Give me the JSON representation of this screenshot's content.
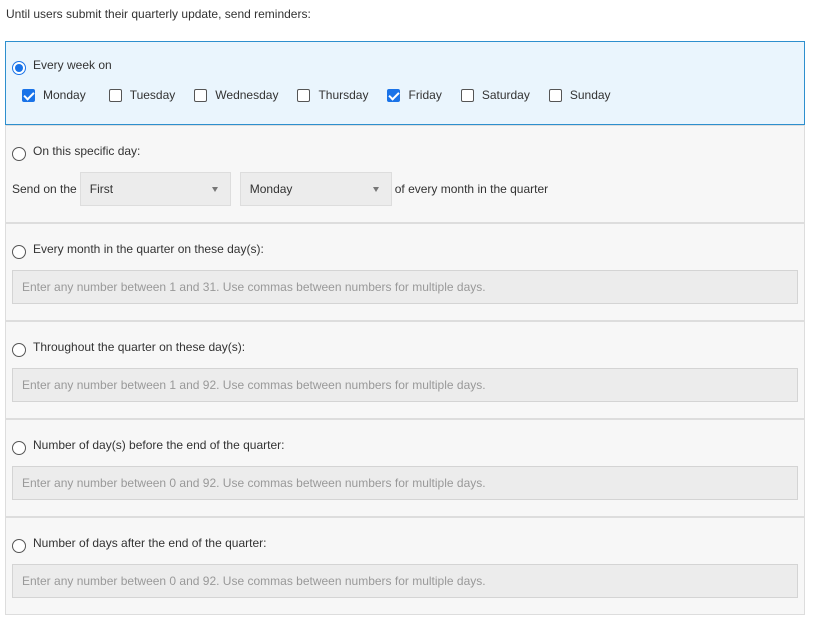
{
  "intro": "Until users submit their quarterly update, send reminders:",
  "weekly": {
    "label": "Every week on",
    "selected": true,
    "days": [
      {
        "label": "Monday",
        "checked": true
      },
      {
        "label": "Tuesday",
        "checked": false
      },
      {
        "label": "Wednesday",
        "checked": false
      },
      {
        "label": "Thursday",
        "checked": false
      },
      {
        "label": "Friday",
        "checked": true
      },
      {
        "label": "Saturday",
        "checked": false
      },
      {
        "label": "Sunday",
        "checked": false
      }
    ]
  },
  "specific_day": {
    "label": "On this specific day:",
    "selected": false,
    "prefix": "Send on the",
    "ordinal_value": "First",
    "weekday_value": "Monday",
    "suffix": "of every month in the quarter"
  },
  "monthly_days": {
    "label": "Every month in the quarter on these day(s):",
    "selected": false,
    "placeholder": "Enter any number between 1 and 31. Use commas between numbers for multiple days."
  },
  "quarter_days": {
    "label": "Throughout the quarter on these day(s):",
    "selected": false,
    "placeholder": "Enter any number between 1 and 92. Use commas between numbers for multiple days."
  },
  "before_end": {
    "label": "Number of day(s) before the end of the quarter:",
    "selected": false,
    "placeholder": "Enter any number between 0 and 92. Use commas between numbers for multiple days."
  },
  "after_end": {
    "label": "Number of days after the end of the quarter:",
    "selected": false,
    "placeholder": "Enter any number between 0 and 92. Use commas between numbers for multiple days."
  },
  "colors": {
    "accent": "#1a73e8",
    "selected_bg": "#eaf5fd",
    "selected_border": "#2d8fce",
    "panel_bg": "#f7f7f7"
  }
}
